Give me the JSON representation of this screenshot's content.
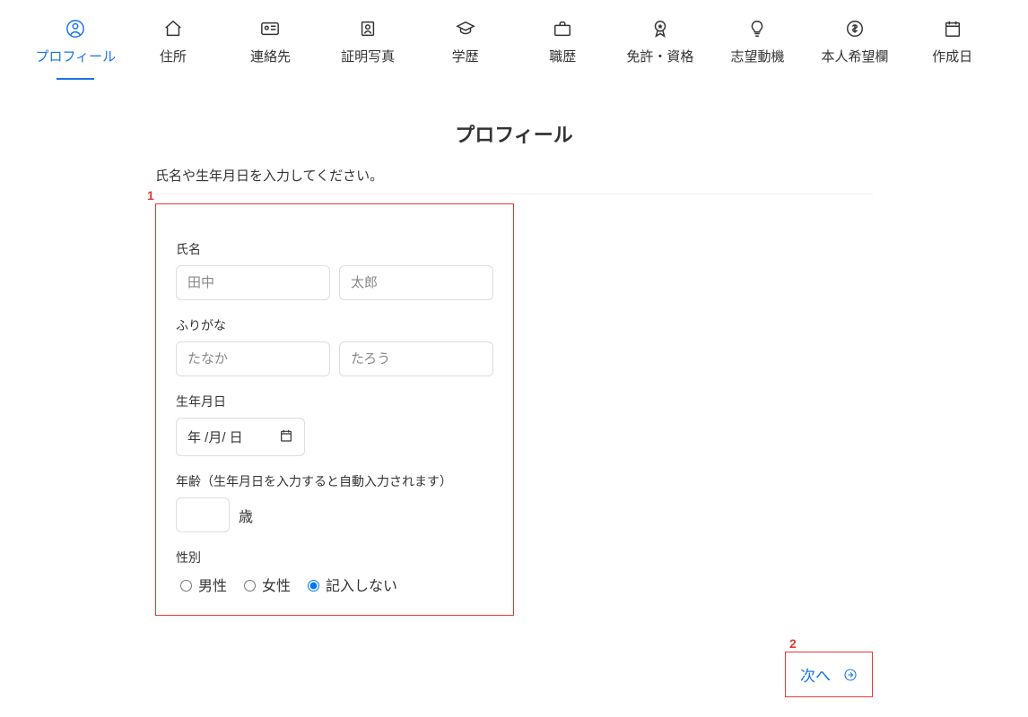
{
  "tabs": [
    {
      "label": "プロフィール",
      "icon": "user-circle"
    },
    {
      "label": "住所",
      "icon": "home"
    },
    {
      "label": "連絡先",
      "icon": "contact-card"
    },
    {
      "label": "証明写真",
      "icon": "id-photo"
    },
    {
      "label": "学歴",
      "icon": "graduation-cap"
    },
    {
      "label": "職歴",
      "icon": "briefcase"
    },
    {
      "label": "免許・資格",
      "icon": "badge"
    },
    {
      "label": "志望動機",
      "icon": "lightbulb"
    },
    {
      "label": "本人希望欄",
      "icon": "dollar-circle"
    },
    {
      "label": "作成日",
      "icon": "calendar"
    }
  ],
  "page": {
    "title": "プロフィール",
    "subtitle": "氏名や生年月日を入力してください。"
  },
  "callouts": {
    "box": "1",
    "next": "2"
  },
  "form": {
    "name_label": "氏名",
    "name_last_placeholder": "田中",
    "name_first_placeholder": "太郎",
    "furigana_label": "ふりがな",
    "furigana_last_placeholder": "たなか",
    "furigana_first_placeholder": "たろう",
    "dob_label": "生年月日",
    "dob_text": "年 /月/ 日",
    "age_label": "年齢（生年月日を入力すると自動入力されます）",
    "age_unit": "歳",
    "gender_label": "性別",
    "gender_options": [
      "男性",
      "女性",
      "記入しない"
    ],
    "gender_selected": "記入しない"
  },
  "buttons": {
    "next": "次へ"
  }
}
